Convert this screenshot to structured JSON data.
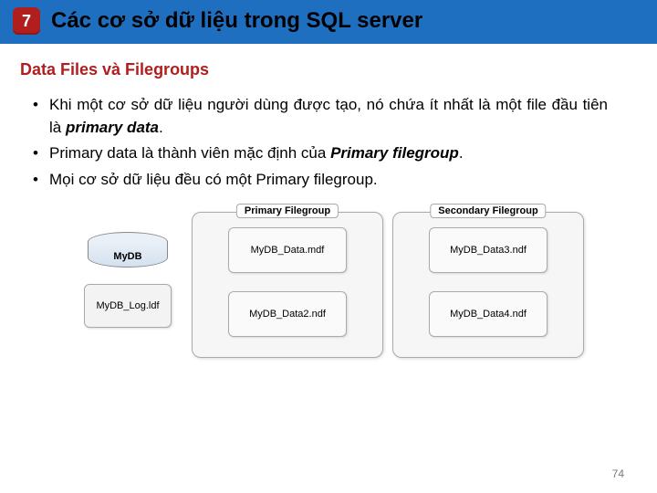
{
  "header": {
    "chapter_number": "7",
    "title": "Các cơ sở dữ liệu trong SQL server"
  },
  "subhead": "Data Files và Filegroups",
  "bullets": [
    {
      "pre": "Khi một cơ sở dữ liệu người dùng được tạo, nó chứa ít nhất là một file đầu tiên là ",
      "em": "primary data",
      "post": "."
    },
    {
      "pre": "Primary data là thành viên mặc định của ",
      "em": "Primary filegroup",
      "post": "."
    },
    {
      "pre": "Mọi cơ sở dữ liệu đều có một Primary filegroup.",
      "em": "",
      "post": ""
    }
  ],
  "diagram": {
    "db_name": "MyDB",
    "log_file": "MyDB_Log.ldf",
    "primary_fg": {
      "label": "Primary Filegroup",
      "files": [
        "MyDB_Data.mdf",
        "MyDB_Data2.ndf"
      ]
    },
    "secondary_fg": {
      "label": "Secondary Filegroup",
      "files": [
        "MyDB_Data3.ndf",
        "MyDB_Data4.ndf"
      ]
    }
  },
  "page_number": "74"
}
